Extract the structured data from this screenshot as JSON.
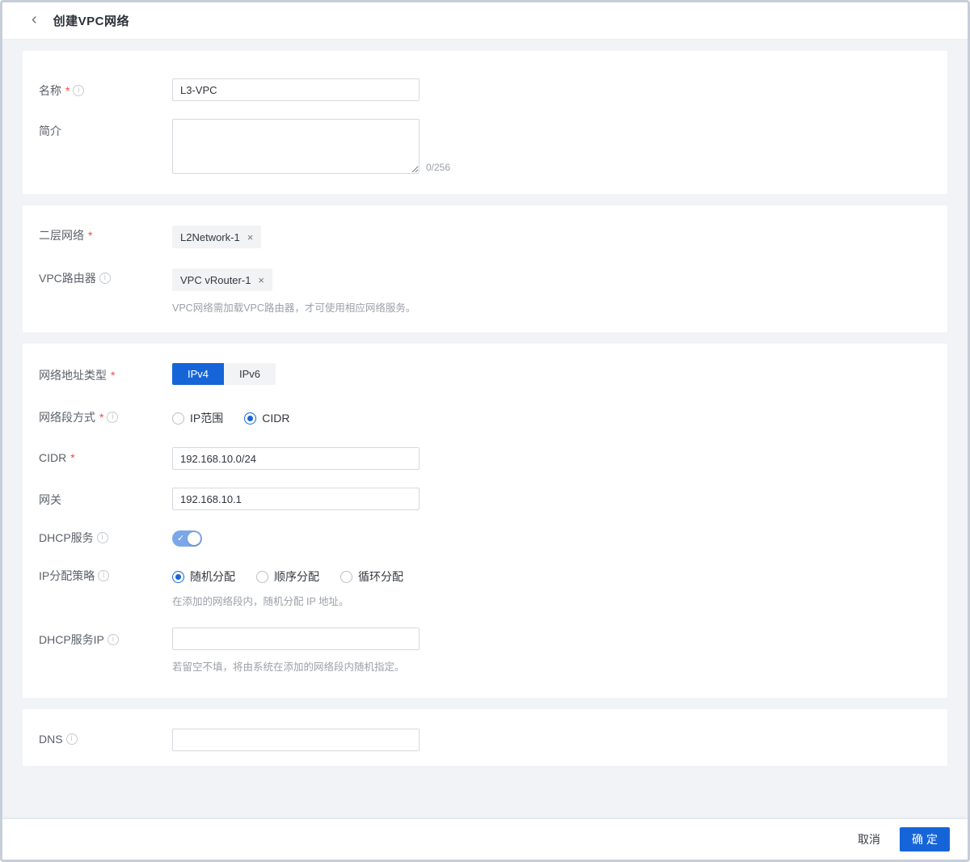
{
  "header": {
    "title": "创建VPC网络",
    "back_icon": "‹"
  },
  "icons": {
    "info": "i",
    "close": "×",
    "check": "✓"
  },
  "form": {
    "name": {
      "label": "名称",
      "required_mark": "*",
      "value": "L3-VPC"
    },
    "description": {
      "label": "简介",
      "value": "",
      "counter": "0/256"
    },
    "l2_network": {
      "label": "二层网络",
      "required_mark": "*",
      "tag": "L2Network-1"
    },
    "vpc_router": {
      "label": "VPC路由器",
      "tag": "VPC vRouter-1",
      "helper": "VPC网络需加载VPC路由器，才可使用相应网络服务。"
    },
    "address_type": {
      "label": "网络地址类型",
      "required_mark": "*",
      "options": [
        "IPv4",
        "IPv6"
      ],
      "selected": "IPv4"
    },
    "segment_mode": {
      "label": "网络段方式",
      "required_mark": "*",
      "options": [
        "IP范围",
        "CIDR"
      ],
      "selected": "CIDR"
    },
    "cidr": {
      "label": "CIDR",
      "required_mark": "*",
      "value": "192.168.10.0/24"
    },
    "gateway": {
      "label": "网关",
      "value": "192.168.10.1"
    },
    "dhcp_service": {
      "label": "DHCP服务",
      "enabled": true
    },
    "ip_allocation": {
      "label": "IP分配策略",
      "options": [
        "随机分配",
        "顺序分配",
        "循环分配"
      ],
      "selected": "随机分配",
      "helper": "在添加的网络段内，随机分配 IP 地址。"
    },
    "dhcp_ip": {
      "label": "DHCP服务IP",
      "value": "",
      "helper": "若留空不填，将由系统在添加的网络段内随机指定。"
    },
    "dns": {
      "label": "DNS",
      "value": ""
    }
  },
  "footer": {
    "cancel_label": "取消",
    "confirm_label": "确定"
  },
  "colors": {
    "primary": "#1665d8",
    "toggle_on": "#7ba7e9",
    "required": "#f0483e",
    "page_background": "#f1f3f7"
  }
}
